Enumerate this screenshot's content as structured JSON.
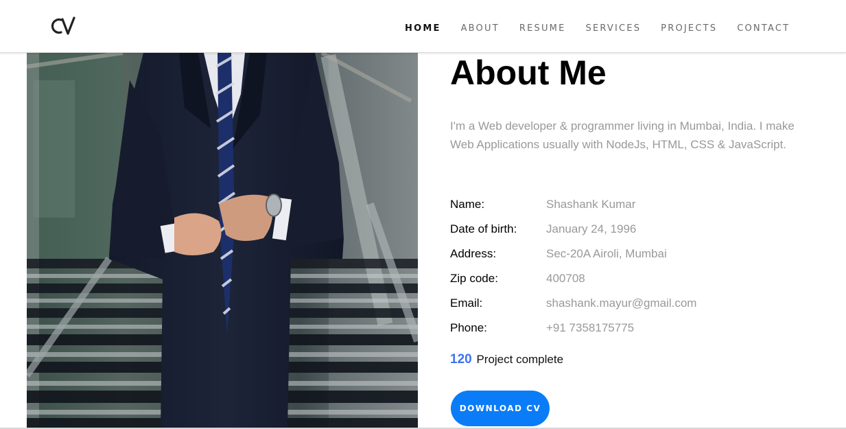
{
  "header": {
    "logo_icon": "cv-logo-icon",
    "nav": [
      {
        "label": "HOME",
        "active": true
      },
      {
        "label": "ABOUT",
        "active": false
      },
      {
        "label": "RESUME",
        "active": false
      },
      {
        "label": "SERVICES",
        "active": false
      },
      {
        "label": "PROJECTS",
        "active": false
      },
      {
        "label": "CONTACT",
        "active": false
      }
    ]
  },
  "about": {
    "title": "About Me",
    "description": "I'm a Web developer & programmer living in Mumbai, India. I make Web Applications usually with NodeJs, HTML, CSS & JavaScript.",
    "info": [
      {
        "label": "Name:",
        "value": "Shashank Kumar"
      },
      {
        "label": "Date of birth:",
        "value": "January 24, 1996"
      },
      {
        "label": "Address:",
        "value": "Sec-20A Airoli, Mumbai"
      },
      {
        "label": "Zip code:",
        "value": "400708"
      },
      {
        "label": "Email:",
        "value": "shashank.mayur@gmail.com"
      },
      {
        "label": "Phone:",
        "value": "+91 7358175775"
      }
    ],
    "projects_count": "120",
    "projects_label": "Project complete",
    "download_label": "DOWNLOAD CV"
  },
  "colors": {
    "accent": "#0b7cf7",
    "count_blue": "#3d72ef",
    "muted_text": "#999999"
  }
}
